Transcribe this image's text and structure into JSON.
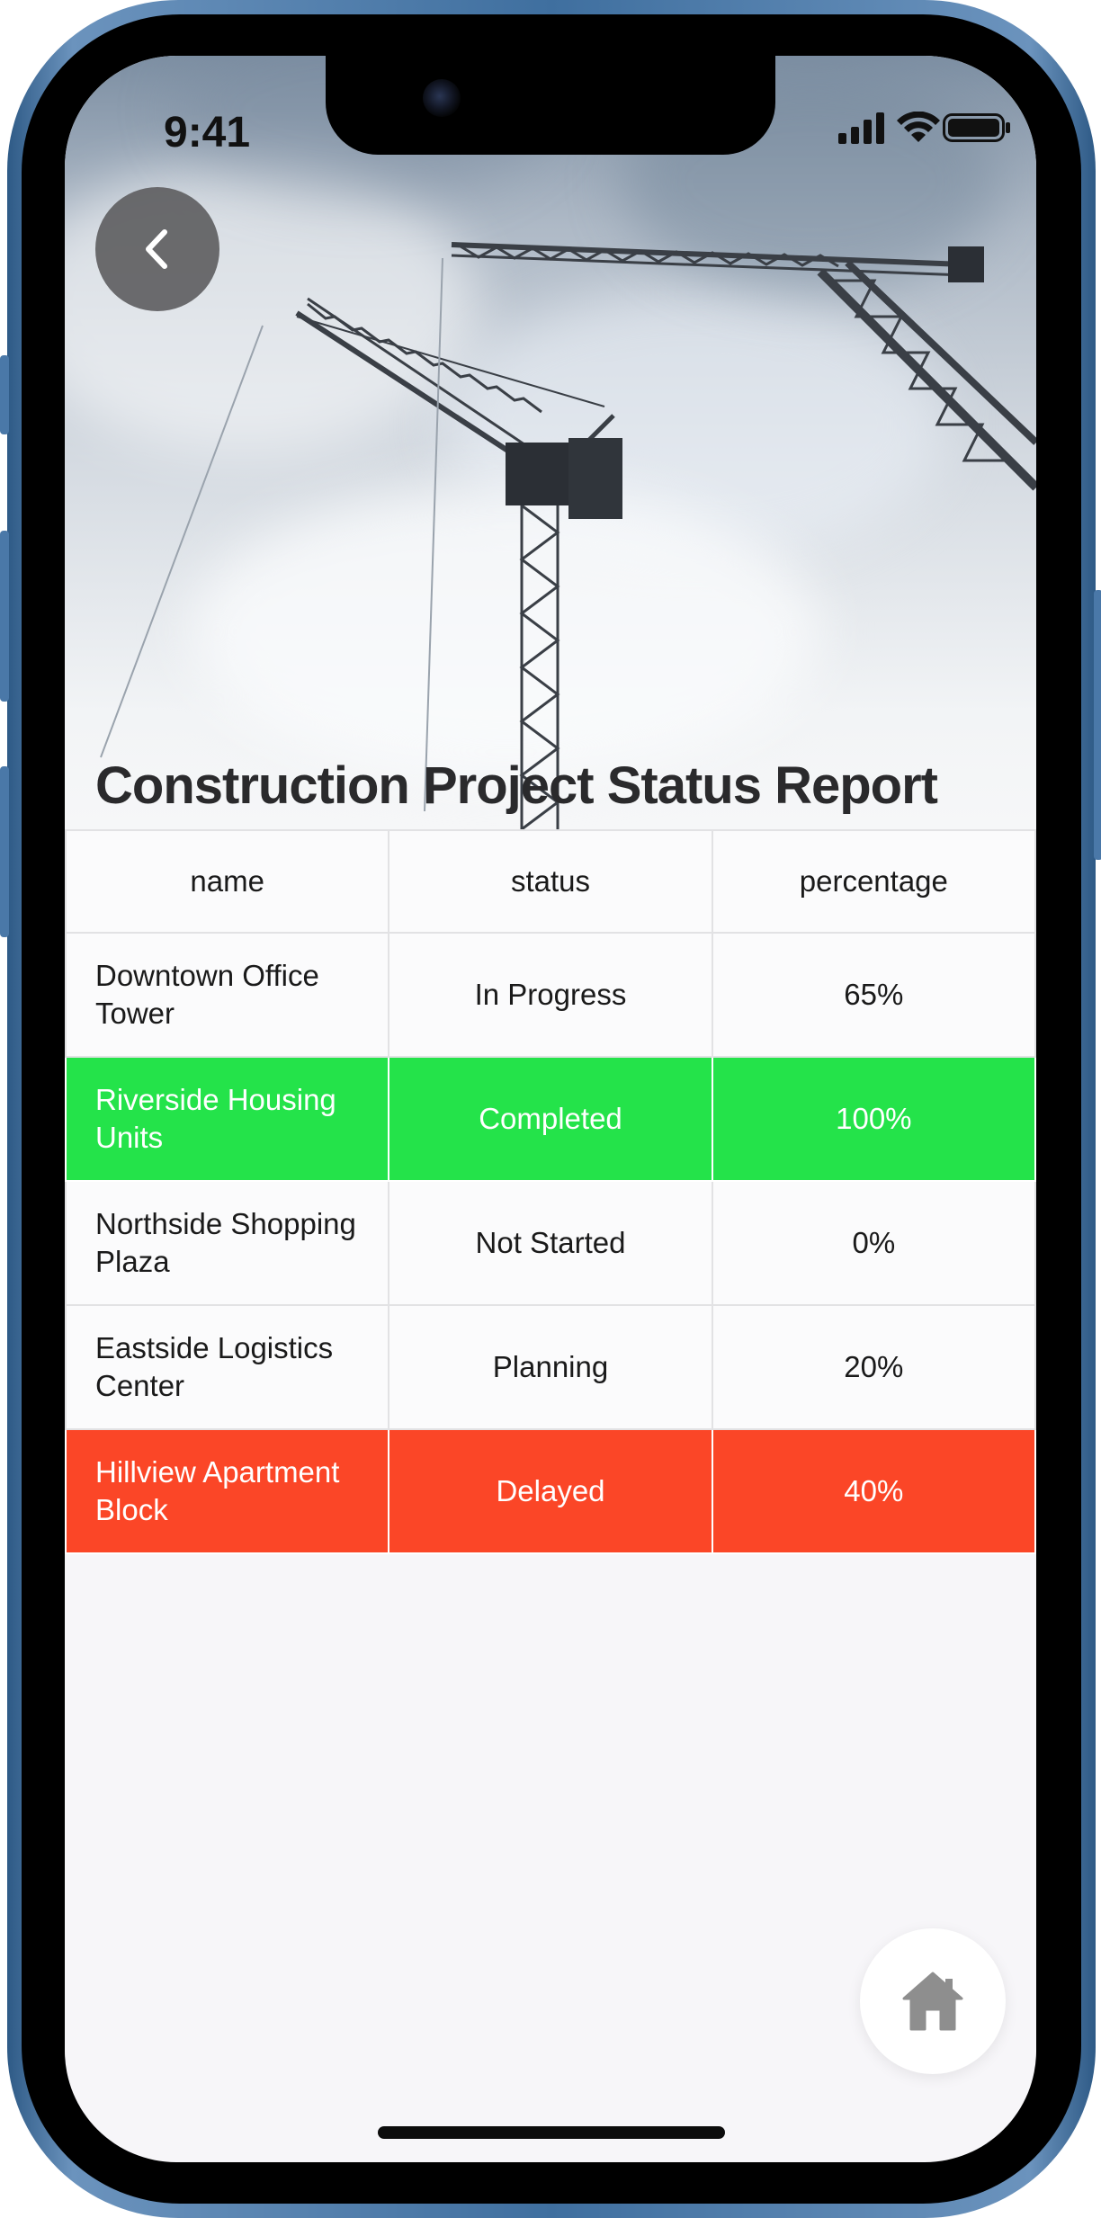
{
  "status_bar": {
    "time": "9:41",
    "icons": [
      "cellular-signal-icon",
      "wifi-icon",
      "battery-icon"
    ]
  },
  "hero": {
    "image": "construction-cranes-sky-photo",
    "back_icon": "chevron-left-icon"
  },
  "page": {
    "title": "Construction Project Status Report"
  },
  "table": {
    "headers": {
      "name": "name",
      "status": "status",
      "percentage": "percentage"
    },
    "rows": [
      {
        "name": "Downtown Office Tower",
        "status": "In Progress",
        "percentage": "65%",
        "highlight": "none"
      },
      {
        "name": "Riverside Housing Units",
        "status": "Completed",
        "percentage": "100%",
        "highlight": "#24e34a"
      },
      {
        "name": "Northside Shopping Plaza",
        "status": "Not Started",
        "percentage": "0%",
        "highlight": "none"
      },
      {
        "name": "Eastside Logistics Center",
        "status": "Planning",
        "percentage": "20%",
        "highlight": "none"
      },
      {
        "name": "Hillview Apartment Block",
        "status": "Delayed",
        "percentage": "40%",
        "highlight": "#fb4627"
      }
    ]
  },
  "fab": {
    "icon": "home-icon"
  },
  "colors": {
    "completed": "#24e34a",
    "delayed": "#fb4627",
    "title_text": "#2a2a2c",
    "back_button": "#606062",
    "home_icon": "#8e8e8e"
  }
}
